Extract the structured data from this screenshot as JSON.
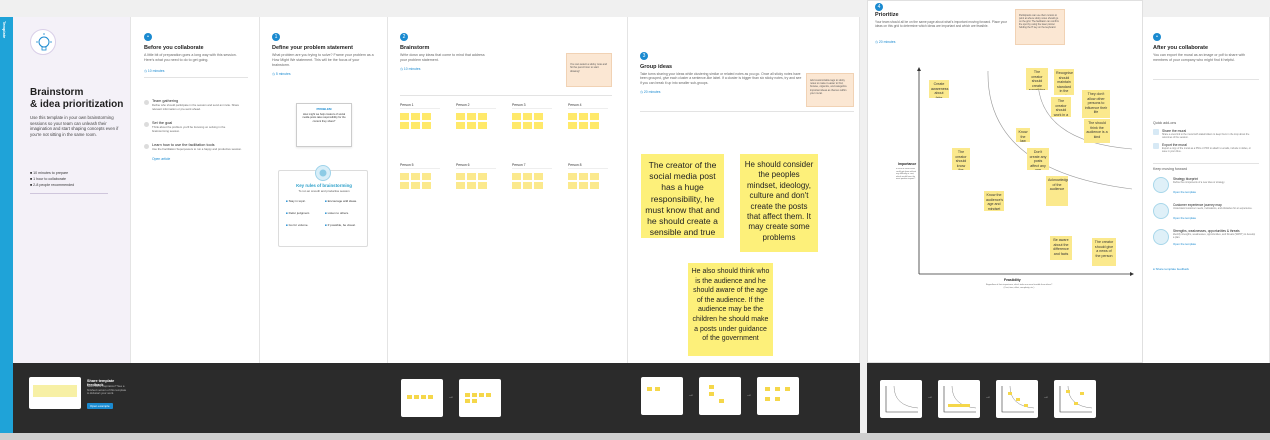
{
  "sidebar": {
    "tag": "Template"
  },
  "intro": {
    "title_line1": "Brainstorm",
    "title_line2": "& idea prioritization",
    "description": "Use this template in your own brainstorming sessions so your team can unleash their imagination and start shaping concepts even if you're not sitting in the same room.",
    "meta": [
      "10 minutes to prepare",
      "1 hour to collaborate",
      "2-8 people recommended"
    ],
    "footer_heading": "Share template feedback",
    "footer_sub": "Need some inspiration? See a finished version of this template to kickstart your work.",
    "footer_button": "Open example"
  },
  "step0": {
    "title": "Before you collaborate",
    "desc": "A little bit of preparation goes a long way with this session. Here's what you need to do to get going.",
    "link": "10 minutes",
    "items": [
      {
        "label": "Team gathering",
        "desc": "Define who should participate in the session and send an invite. Share relevant information or pre-work ahead."
      },
      {
        "label": "Set the goal",
        "desc": "Think about the problem you'll be focusing on solving in the brainstorming session."
      },
      {
        "label": "Learn how to use the facilitation tools",
        "desc": "Use the Facilitation Superpowers to run a happy and productive session."
      }
    ],
    "item_link": "Open article"
  },
  "step1": {
    "num": "1",
    "title": "Define your problem statement",
    "desc": "What problem are you trying to solve? Frame your problem as a How Might We statement. This will be the focus of your brainstorm.",
    "link": "5 minutes",
    "card_title": "PROBLEM",
    "card_text": "How might we help creators of social media posts take responsibility for the content they share?",
    "tips_title": "Key rules of brainstorming",
    "tips_sub": "To run an smooth and productive session",
    "tips": [
      "Stay in topic.",
      "Encourage wild ideas.",
      "Defer judgment.",
      "Listen to others.",
      "Go for volume.",
      "If possible, be visual."
    ]
  },
  "step2": {
    "num": "2",
    "title": "Brainstorm",
    "desc": "Write down any ideas that come to mind that address your problem statement.",
    "link": "10 minutes",
    "tip": "You can select a sticky note and hit the pencil icon to start drawing!",
    "people": [
      "Person 1",
      "Person 2",
      "Person 3",
      "Person 4",
      "Person 5",
      "Person 6",
      "Person 7",
      "Person 8"
    ]
  },
  "step3": {
    "num": "3",
    "title": "Group ideas",
    "desc": "Take turns sharing your ideas while clustering similar or related notes as you go. Once all sticky notes have been grouped, give each cluster a sentence-like label. If a cluster is bigger than six sticky notes, try and see if you can break it up into smaller sub-groups.",
    "link": "20 minutes",
    "tip": "Add customizable tags to sticky notes to make it easier to find, browse, organize, and categorize important ideas as themes within your mural.",
    "notes": [
      "The creator of the social media post has a huge responsibility, he must know that and he should create a sensible and true",
      "He should consider the peoples mindset, ideology, culture and don't create the posts that affect them. It may create some problems",
      "He also should think who is the audience and he should aware of the age of the audience. If the audience may be the children he should make a posts under guidance of the government"
    ]
  },
  "step4": {
    "num": "4",
    "title": "Prioritize",
    "desc": "Your team should all be on the same page about what's important moving forward. Place your ideas on this grid to determine which ideas are important and which are feasible.",
    "link": "20 minutes",
    "tip": "Participants can use their cursors to point at where sticky notes should go on the grid. The facilitator can confirm the spot by using the laser pointer holding the H key on the keyboard.",
    "y_label": "Importance",
    "y_sub": "If each of these tasks could get done without any difficulty or cost, which would have the most positive impact?",
    "x_label": "Feasibility",
    "x_sub": "Regardless of their importance, which tasks are more feasible than others? (Cost, time, effort, complexity, etc.)",
    "notes": [
      "Create awareness about fake posts in media",
      "The creator should know the audience",
      "Know the audience's age and mindset",
      "The creator should create something original",
      "Recognise should maintain standard in the posts",
      "The creator should work in a good way",
      "Know the law and rules",
      "Don't create any posts affect any one",
      "Acknowledge of the audience",
      "They don't allow other persons to influence their life",
      "Be aware about the difference and facts",
      "The creator should give a news of the person",
      "The should think the audience is a kind"
    ]
  },
  "step5": {
    "title": "After you collaborate",
    "desc": "You can export the mural as an image or pdf to share with members of your company who might find it helpful.",
    "quick_title": "Quick add-ons",
    "quick": [
      {
        "label": "Share the mural",
        "desc": "Share a view link to the mural with stakeholders to keep them in the loop about the outcomes of the session."
      },
      {
        "label": "Export the mural",
        "desc": "Export a copy of the mural as a PNG or PDF to attach to emails, include in slides, or save in your drive."
      }
    ],
    "keep_title": "Keep moving forward",
    "keep": [
      {
        "label": "Strategy blueprint",
        "desc": "Define the components of a new idea or strategy.",
        "link": "Open the template"
      },
      {
        "label": "Customer experience journey map",
        "desc": "Understand customer needs, motivations, and obstacles for an experience.",
        "link": "Open the template"
      },
      {
        "label": "Strengths, weaknesses, opportunities & threats",
        "desc": "Identify strengths, weaknesses, opportunities, and threats (SWOT) to develop a plan.",
        "link": "Open the template"
      }
    ],
    "footer_link": "Share template feedback"
  },
  "colors": {
    "accent": "#1a8ad0",
    "sticky": "#fdf07a",
    "sidebar": "#1fa3d8",
    "footer": "#2b2b2b"
  }
}
